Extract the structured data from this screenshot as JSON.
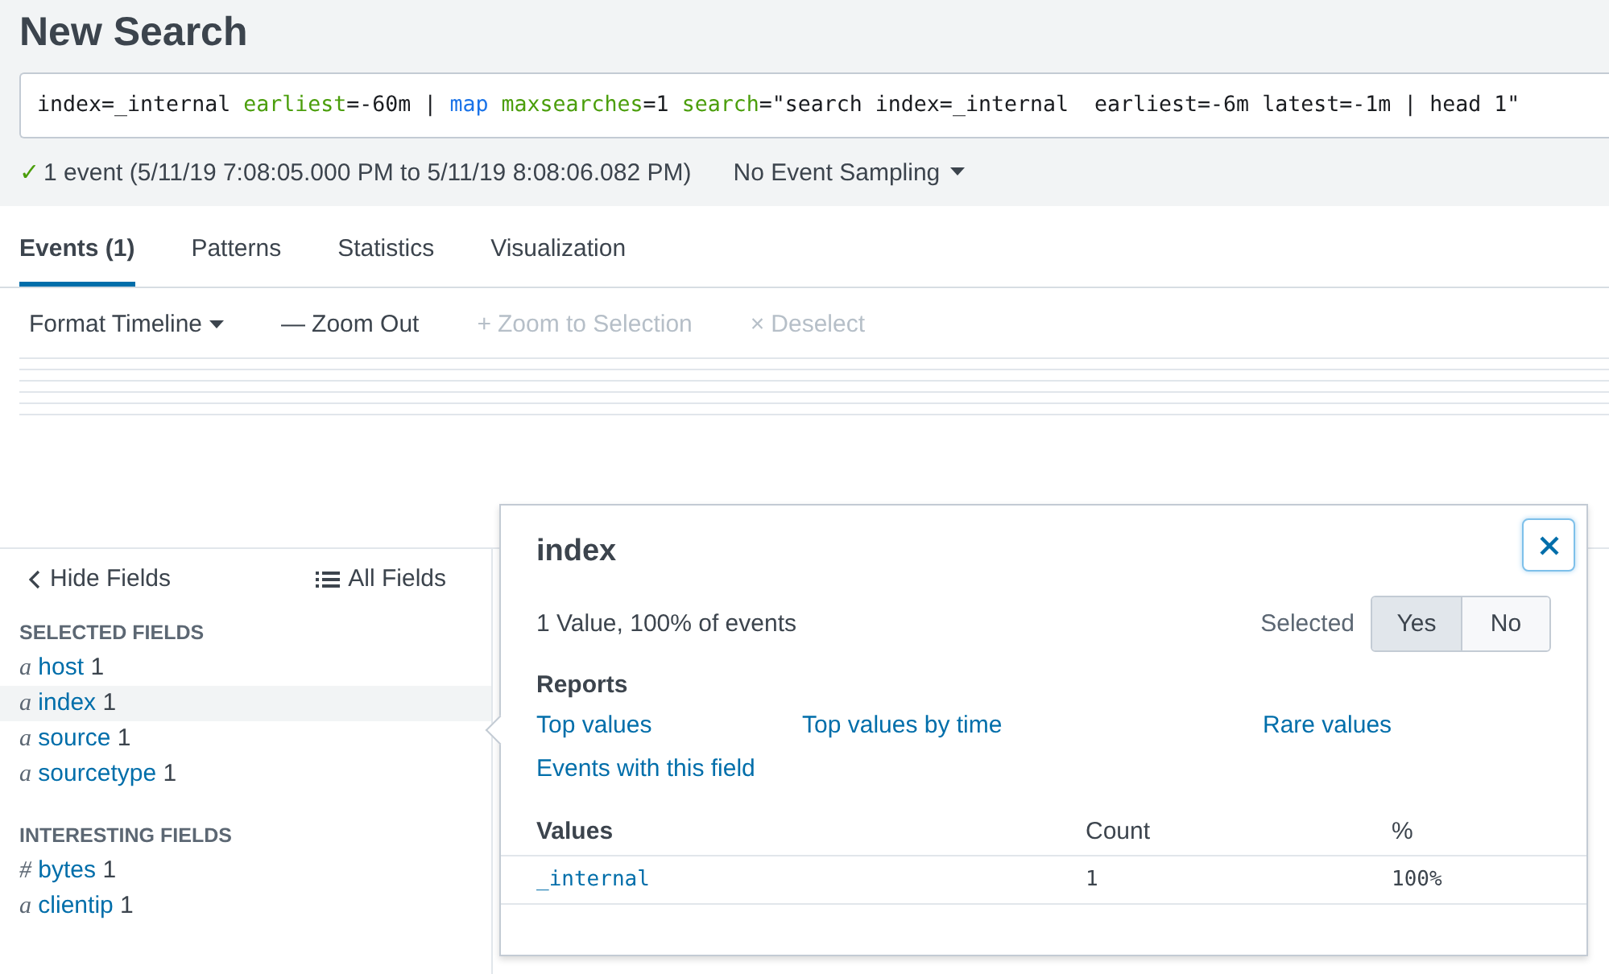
{
  "page_title": "New Search",
  "query": [
    {
      "text": "index=_internal ",
      "kind": "plain"
    },
    {
      "text": "earliest",
      "kind": "keyword"
    },
    {
      "text": "=-60m | ",
      "kind": "plain"
    },
    {
      "text": "map ",
      "kind": "command"
    },
    {
      "text": "maxsearches",
      "kind": "keyword"
    },
    {
      "text": "=1 ",
      "kind": "plain"
    },
    {
      "text": "search",
      "kind": "keyword"
    },
    {
      "text": "=\"search index=_internal  earliest=-6m latest=-1m | head 1\"",
      "kind": "plain"
    }
  ],
  "status": {
    "check": "✓",
    "text": "1 event (5/11/19 7:08:05.000 PM to 5/11/19 8:08:06.082 PM)",
    "sampling": "No Event Sampling"
  },
  "tabs": [
    {
      "label": "Events (1)",
      "selected": true
    },
    {
      "label": "Patterns",
      "selected": false
    },
    {
      "label": "Statistics",
      "selected": false
    },
    {
      "label": "Visualization",
      "selected": false
    }
  ],
  "timeline_actions": [
    {
      "label": "Format Timeline",
      "disabled": false,
      "caret": true
    },
    {
      "icon": "—",
      "label": "Zoom Out",
      "disabled": false,
      "caret": false
    },
    {
      "icon": "+",
      "label": "Zoom to Selection",
      "disabled": true,
      "caret": false
    },
    {
      "icon": "×",
      "label": "Deselect",
      "disabled": true,
      "caret": false
    }
  ],
  "sidebar": {
    "hide": "Hide Fields",
    "all": "All Fields",
    "groups": [
      {
        "title": "SELECTED FIELDS",
        "fields": [
          {
            "type": "a",
            "name": "host",
            "count": "1",
            "selected": false
          },
          {
            "type": "a",
            "name": "index",
            "count": "1",
            "selected": true
          },
          {
            "type": "a",
            "name": "source",
            "count": "1",
            "selected": false
          },
          {
            "type": "a",
            "name": "sourcetype",
            "count": "1",
            "selected": false
          }
        ]
      },
      {
        "title": "INTERESTING FIELDS",
        "fields": [
          {
            "type": "#",
            "name": "bytes",
            "count": "1",
            "selected": false
          },
          {
            "type": "a",
            "name": "clientip",
            "count": "1",
            "selected": false
          }
        ]
      }
    ]
  },
  "popover": {
    "title": "index",
    "summary": "1 Value, 100% of events",
    "selected_label": "Selected",
    "choices": [
      {
        "label": "Yes",
        "selected": true
      },
      {
        "label": "No",
        "selected": false
      }
    ],
    "reports_title": "Reports",
    "reports": [
      "Top values",
      "Top values by time",
      "Rare values",
      "Events with this field"
    ],
    "columns": [
      "Values",
      "Count",
      "%"
    ],
    "rows": [
      {
        "value": "_internal",
        "count": "1",
        "percent": "100%"
      }
    ]
  }
}
